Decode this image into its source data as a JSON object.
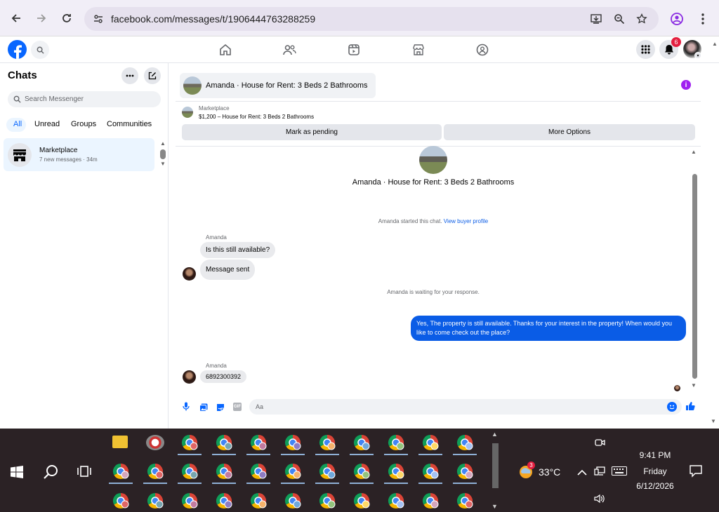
{
  "browser": {
    "url": "facebook.com/messages/t/1906444763288259"
  },
  "header": {
    "notifications_count": "6"
  },
  "chats": {
    "title": "Chats",
    "search_placeholder": "Search Messenger",
    "filters": [
      "All",
      "Unread",
      "Groups",
      "Communities"
    ],
    "items": [
      {
        "name": "Marketplace",
        "preview": "7 new messages · 34m"
      }
    ]
  },
  "conversation": {
    "header_title": "Amanda · House for Rent: 3 Beds 2 Bathrooms",
    "marketplace_label": "Marketplace",
    "listing_line": "$1,200 – House for Rent: 3 Beds 2 Bathrooms",
    "mark_pending_label": "Mark as pending",
    "more_options_label": "More Options",
    "profile_title": "Amanda · House for Rent: 3 Beds 2 Bathrooms",
    "started_text": "Amanda started this chat.",
    "view_profile_link": "View buyer profile",
    "sender_name_1": "Amanda",
    "msg_1": "Is this still available?",
    "msg_2": "Message sent",
    "waiting_text": "Amanda is waiting for your response.",
    "outgoing_msg": "Yes, The property is still available. Thanks for your interest in the property! When would you like to come check out the place?",
    "sender_name_2": "Amanda",
    "msg_3": "6892300392",
    "composer_placeholder": "Aa"
  },
  "taskbar": {
    "weather_badge": "3",
    "temperature": "33°C",
    "time": "9:41 PM",
    "day": "Friday",
    "date": "6/12/2026"
  },
  "colors": {
    "accent": "#0866ff",
    "outgoing_bubble": "#0a5ce6",
    "notification_badge": "#e41e3f",
    "info_icon": "#a020f0"
  }
}
